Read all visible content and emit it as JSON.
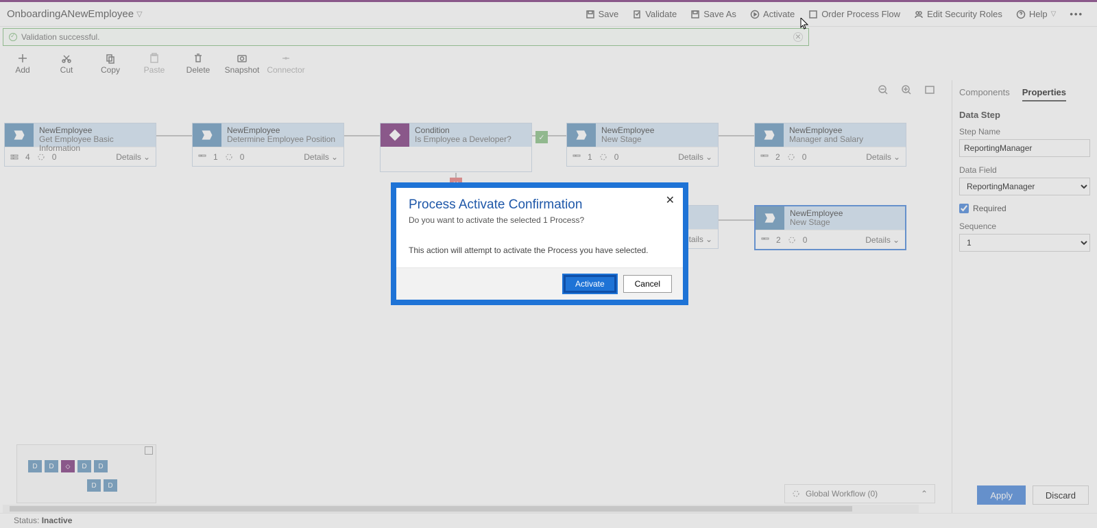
{
  "header": {
    "title": "OnboardingANewEmployee",
    "buttons": {
      "save": "Save",
      "validate": "Validate",
      "save_as": "Save As",
      "activate": "Activate",
      "order": "Order Process Flow",
      "edit_roles": "Edit Security Roles",
      "help": "Help"
    }
  },
  "validation_msg": "Validation successful.",
  "toolbar": {
    "add": "Add",
    "cut": "Cut",
    "copy": "Copy",
    "paste": "Paste",
    "delete": "Delete",
    "snapshot": "Snapshot",
    "connector": "Connector"
  },
  "stages": {
    "s1": {
      "entity": "NewEmployee",
      "name": "Get Employee Basic Information",
      "steps": "4",
      "wf": "0",
      "details": "Details"
    },
    "s2": {
      "entity": "NewEmployee",
      "name": "Determine Employee Position",
      "steps": "1",
      "wf": "0",
      "details": "Details"
    },
    "s3": {
      "entity": "Condition",
      "name": "Is Employee a Developer?"
    },
    "s4": {
      "entity": "NewEmployee",
      "name": "New Stage",
      "steps": "1",
      "wf": "0",
      "details": "Details"
    },
    "s5": {
      "entity": "NewEmployee",
      "name": "Manager and Salary",
      "steps": "2",
      "wf": "0",
      "details": "Details"
    },
    "s6": {
      "details": "Details"
    },
    "s7": {
      "entity": "NewEmployee",
      "name": "New Stage",
      "steps": "2",
      "wf": "0",
      "details": "Details"
    }
  },
  "global_wf": "Global Workflow (0)",
  "right_panel": {
    "tab_components": "Components",
    "tab_properties": "Properties",
    "section": "Data Step",
    "step_name_label": "Step Name",
    "step_name_value": "ReportingManager",
    "data_field_label": "Data Field",
    "data_field_value": "ReportingManager",
    "required_label": "Required",
    "sequence_label": "Sequence",
    "sequence_value": "1",
    "apply": "Apply",
    "discard": "Discard"
  },
  "modal": {
    "title": "Process Activate Confirmation",
    "subtitle": "Do you want to activate the selected 1 Process?",
    "body": "This action will attempt to activate the Process you have selected.",
    "activate": "Activate",
    "cancel": "Cancel"
  },
  "footer": {
    "status_label": "Status:",
    "status_value": "Inactive"
  }
}
